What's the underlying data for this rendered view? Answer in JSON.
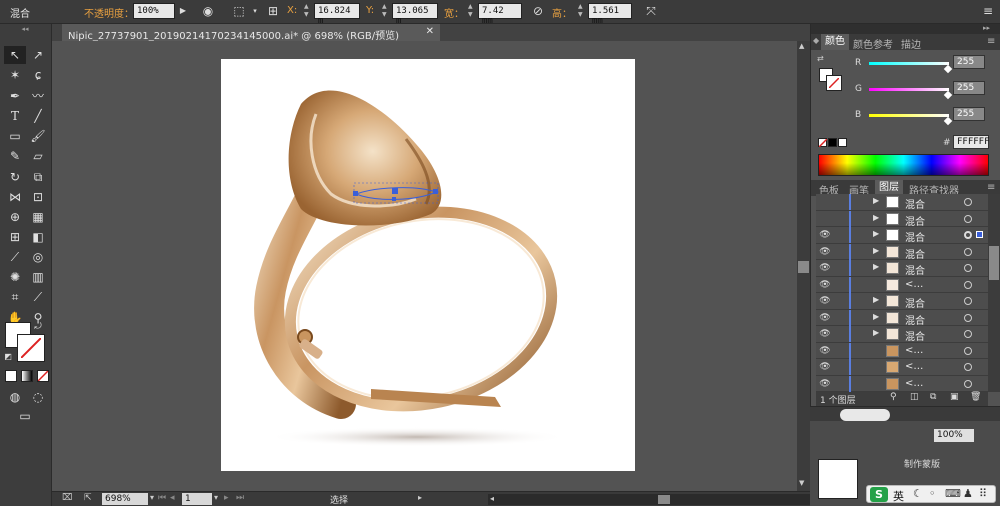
{
  "control_bar": {
    "object_type": "混合",
    "opacity_label": "不透明度：",
    "opacity_value": "100%",
    "x_label": "X:",
    "x_value": "16.824 m",
    "y_label": "Y:",
    "y_value": "13.065 m",
    "width_label": "宽：",
    "width_value": "7.42 mm",
    "height_label": "高：",
    "height_value": "1.561 mm"
  },
  "document": {
    "tab_title": "Nipic_27737901_20190214170234145000.ai* @ 698% (RGB/预览)"
  },
  "status_bar": {
    "zoom": "698%",
    "page": "1",
    "tool": "选择"
  },
  "color_panel": {
    "tabs": [
      "颜色",
      "颜色参考",
      "描边"
    ],
    "r_label": "R",
    "g_label": "G",
    "b_label": "B",
    "r_value": "255",
    "g_value": "255",
    "b_value": "255",
    "hex_label": "#",
    "hex_value": "FFFFFF"
  },
  "layers_panel": {
    "tabs": [
      "色板",
      "画笔",
      "图层",
      "路径查找器"
    ],
    "rows": [
      {
        "name": "混合",
        "eye": false
      },
      {
        "name": "混合",
        "eye": false
      },
      {
        "name": "混合",
        "eye": true
      },
      {
        "name": "混合",
        "eye": true
      },
      {
        "name": "混合",
        "eye": true
      },
      {
        "name": "<…",
        "eye": true
      },
      {
        "name": "混合",
        "eye": true
      },
      {
        "name": "混合",
        "eye": true
      },
      {
        "name": "混合",
        "eye": true
      },
      {
        "name": "<…",
        "eye": true
      },
      {
        "name": "<…",
        "eye": true
      },
      {
        "name": "<…",
        "eye": true
      }
    ],
    "footer": "1 个图层"
  },
  "bottom_panel": {
    "opacity_value": "100%",
    "partial_label": "制作蒙版",
    "ime_text": "英"
  },
  "colors": {
    "ui_dark": "#3b3b3b",
    "canvas": "#535353",
    "accent_orange": "#e8a040",
    "selection_blue": "#3a5fd9"
  }
}
